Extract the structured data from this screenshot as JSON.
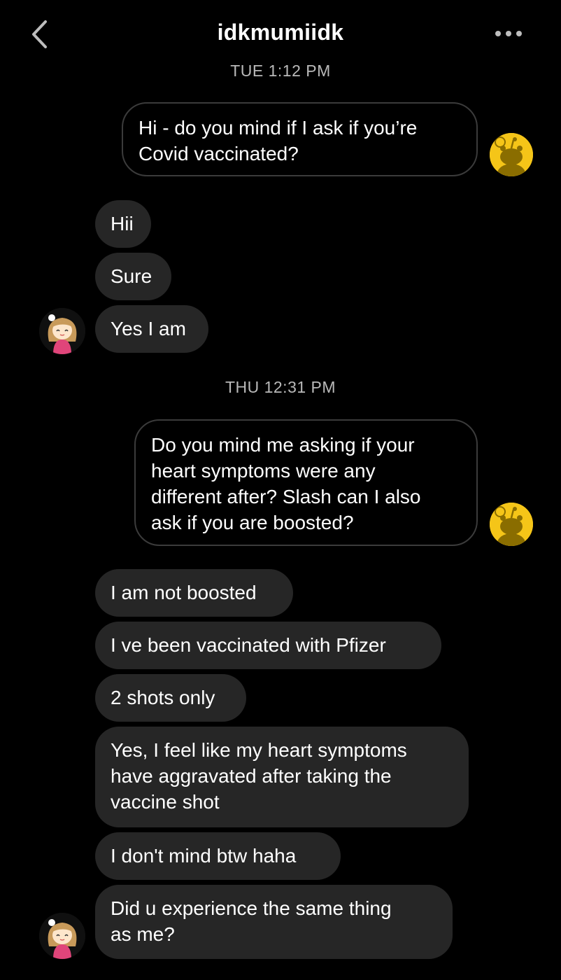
{
  "header": {
    "title": "idkmumiidk",
    "back_icon": "chevron-left-icon",
    "more_icon": "more-horizontal-icon"
  },
  "colors": {
    "background": "#000000",
    "incoming_bubble": "#262626",
    "outgoing_border": "#3b3b3b",
    "timestamp": "#b9b9b9",
    "self_avatar": "#f5c518"
  },
  "timestamps": {
    "first": "TUE 1:12 PM",
    "second": "THU 12:31 PM"
  },
  "messages": {
    "m1": {
      "direction": "outgoing",
      "lines": [
        "Hi - do you mind if I ask if you’re",
        "Covid vaccinated?"
      ]
    },
    "m2": {
      "direction": "incoming",
      "lines": [
        "Hii"
      ]
    },
    "m3": {
      "direction": "incoming",
      "lines": [
        "Sure"
      ]
    },
    "m4": {
      "direction": "incoming",
      "lines": [
        "Yes I am"
      ]
    },
    "m5": {
      "direction": "outgoing",
      "lines": [
        "Do you mind me asking if your",
        "heart symptoms were any",
        "different after? Slash can I also",
        "ask if you are boosted?"
      ]
    },
    "m6": {
      "direction": "incoming",
      "lines": [
        "I am not boosted"
      ]
    },
    "m7": {
      "direction": "incoming",
      "lines": [
        "I ve been vaccinated with Pfizer"
      ]
    },
    "m8": {
      "direction": "incoming",
      "lines": [
        "2 shots only"
      ]
    },
    "m9": {
      "direction": "incoming",
      "lines": [
        "Yes, I feel like my heart symptoms",
        "have aggravated after taking the",
        "vaccine shot"
      ]
    },
    "m10": {
      "direction": "incoming",
      "lines": [
        "I don't mind btw haha"
      ]
    },
    "m11": {
      "direction": "incoming",
      "lines": [
        "Did u experience the same thing",
        "as me?"
      ]
    }
  },
  "avatars": {
    "self": "snoo-avatar-icon",
    "other": "anime-girl-avatar-icon"
  }
}
